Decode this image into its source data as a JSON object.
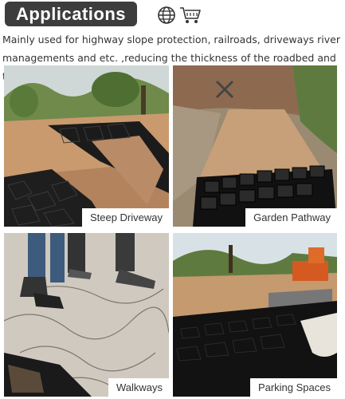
{
  "header": {
    "title": "Applications",
    "icons": [
      "globe-icon",
      "shopping-cart-icon"
    ]
  },
  "description": "Mainly used for highway slope protection, railroads, driveways river managements and etc. ,reducing the thickness of the roadbed and the cost of the project.",
  "panels": [
    {
      "label": "Steep Driveway"
    },
    {
      "label": "Garden Pathway"
    },
    {
      "label": "Walkways"
    },
    {
      "label": "Parking Spaces"
    }
  ],
  "colors": {
    "header_bg": "#3d3d3d",
    "grid": "#141414",
    "soil": "#a9785a",
    "gravel": "#cfc9c0"
  }
}
